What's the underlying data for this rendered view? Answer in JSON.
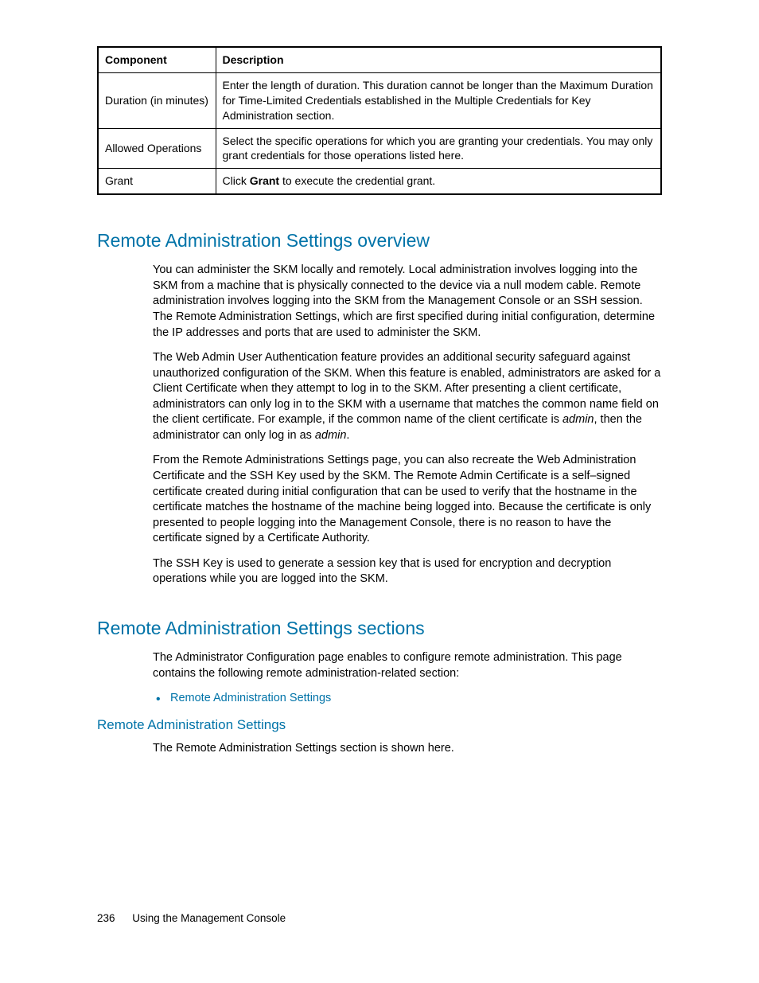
{
  "table": {
    "header": {
      "component": "Component",
      "description": "Description"
    },
    "rows": [
      {
        "component": "Duration (in minutes)",
        "description": "Enter the length of duration. This duration cannot be longer than the Maximum Duration for Time-Limited Credentials established in the Multiple Credentials for Key Administration section."
      },
      {
        "component": "Allowed Operations",
        "description": "Select the specific operations for which you are granting your credentials. You may only grant credentials for those operations listed here."
      },
      {
        "component": "Grant",
        "description_pre": "Click ",
        "description_bold": "Grant",
        "description_post": " to execute the credential grant."
      }
    ]
  },
  "section1": {
    "heading": "Remote Administration Settings overview",
    "p1": "You can administer the SKM locally and remotely. Local administration involves logging into the SKM from a machine that is physically connected to the device via a null modem cable. Remote administration involves logging into the SKM from the Management Console or an SSH session. The Remote Administration Settings, which are first specified during initial configuration, determine the IP addresses and ports that are used to administer the SKM.",
    "p2_a": "The Web Admin User Authentication feature provides an additional security safeguard against unauthorized configuration of the SKM. When this feature is enabled, administrators are asked for a Client Certificate when they attempt to log in to the SKM. After presenting a client certificate, administrators can only log in to the SKM with a username that matches the common name field on the client certificate. For example, if the common name of the client certificate is ",
    "p2_italic1": "admin",
    "p2_b": ", then the administrator can only log in as ",
    "p2_italic2": "admin",
    "p2_c": ".",
    "p3": "From the Remote Administrations Settings page, you can also recreate the Web Administration Certificate and the SSH Key used by the SKM. The Remote Admin Certificate is a self–signed certificate created during initial configuration that can be used to verify that the hostname in the certificate matches the hostname of the machine being logged into. Because the certificate is only presented to people logging into the Management Console, there is no reason to have the certificate signed by a Certificate Authority.",
    "p4": "The SSH Key is used to generate a session key that is used for encryption and decryption operations while you are logged into the SKM."
  },
  "section2": {
    "heading": "Remote Administration Settings sections",
    "p1": "The Administrator Configuration page enables to configure remote administration. This page contains the following remote administration-related section:",
    "bullet1": "Remote Administration Settings",
    "subheading": "Remote Administration Settings",
    "p2": "The Remote Administration Settings section is shown here."
  },
  "footer": {
    "page_number": "236",
    "chapter": "Using the Management Console"
  }
}
